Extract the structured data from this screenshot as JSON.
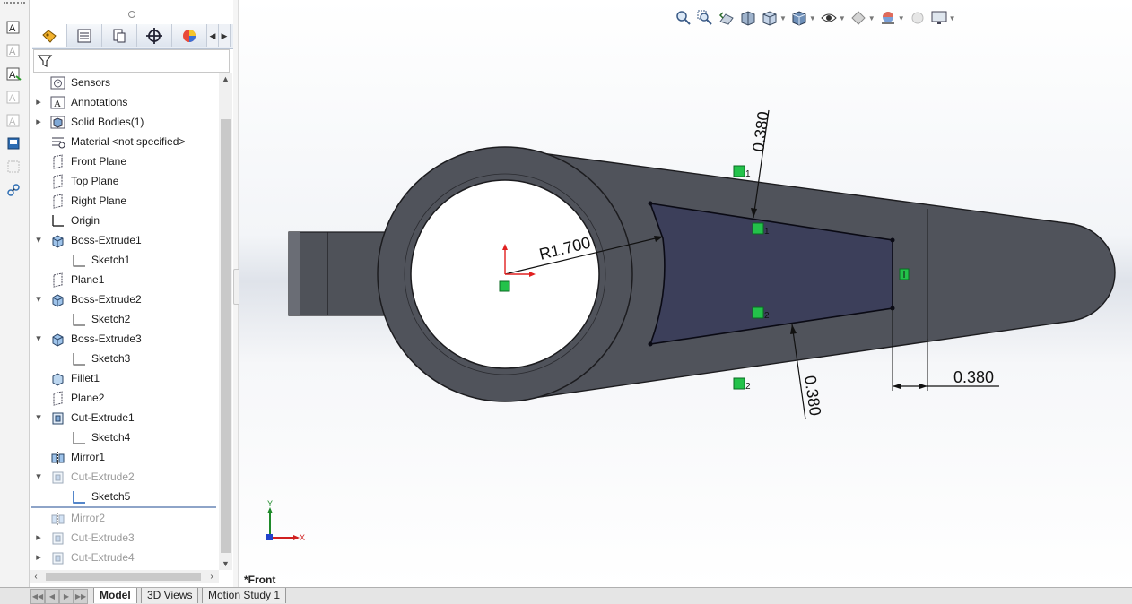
{
  "feature_tree": {
    "items": [
      {
        "label": "Sensors",
        "icon": "sensor-icon",
        "expand": false,
        "indent": 0,
        "dim": false
      },
      {
        "label": "Annotations",
        "icon": "annotations-icon",
        "expand": true,
        "indent": 0,
        "dim": false
      },
      {
        "label": "Solid Bodies(1)",
        "icon": "solid-bodies-icon",
        "expand": true,
        "indent": 0,
        "dim": false
      },
      {
        "label": "Material <not specified>",
        "icon": "material-icon",
        "expand": false,
        "indent": 0,
        "dim": false
      },
      {
        "label": "Front Plane",
        "icon": "plane-icon",
        "expand": false,
        "indent": 0,
        "dim": false
      },
      {
        "label": "Top Plane",
        "icon": "plane-icon",
        "expand": false,
        "indent": 0,
        "dim": false
      },
      {
        "label": "Right Plane",
        "icon": "plane-icon",
        "expand": false,
        "indent": 0,
        "dim": false
      },
      {
        "label": "Origin",
        "icon": "origin-icon",
        "expand": false,
        "indent": 0,
        "dim": false
      },
      {
        "label": "Boss-Extrude1",
        "icon": "extrude-icon",
        "expand": "open",
        "indent": 0,
        "dim": false
      },
      {
        "label": "Sketch1",
        "icon": "sketch-icon",
        "expand": false,
        "indent": 1,
        "dim": false
      },
      {
        "label": "Plane1",
        "icon": "plane-icon",
        "expand": false,
        "indent": 0,
        "dim": false
      },
      {
        "label": "Boss-Extrude2",
        "icon": "extrude-icon",
        "expand": "open",
        "indent": 0,
        "dim": false
      },
      {
        "label": "Sketch2",
        "icon": "sketch-icon",
        "expand": false,
        "indent": 1,
        "dim": false
      },
      {
        "label": "Boss-Extrude3",
        "icon": "extrude-icon",
        "expand": "open",
        "indent": 0,
        "dim": false
      },
      {
        "label": "Sketch3",
        "icon": "sketch-icon",
        "expand": false,
        "indent": 1,
        "dim": false
      },
      {
        "label": "Fillet1",
        "icon": "fillet-icon",
        "expand": false,
        "indent": 0,
        "dim": false
      },
      {
        "label": "Plane2",
        "icon": "plane-icon",
        "expand": false,
        "indent": 0,
        "dim": false
      },
      {
        "label": "Cut-Extrude1",
        "icon": "cut-extrude-icon",
        "expand": "open",
        "indent": 0,
        "dim": false
      },
      {
        "label": "Sketch4",
        "icon": "sketch-icon",
        "expand": false,
        "indent": 1,
        "dim": false
      },
      {
        "label": "Mirror1",
        "icon": "mirror-icon",
        "expand": false,
        "indent": 0,
        "dim": false
      },
      {
        "label": "Cut-Extrude2",
        "icon": "cut-extrude-icon",
        "expand": "open",
        "indent": 0,
        "dim": true
      },
      {
        "label": "Sketch5",
        "icon": "sketch-active-icon",
        "expand": false,
        "indent": 1,
        "dim": false
      },
      {
        "label": "Mirror2",
        "icon": "mirror-icon",
        "expand": false,
        "indent": 0,
        "dim": true
      },
      {
        "label": "Cut-Extrude3",
        "icon": "cut-extrude-icon",
        "expand": true,
        "indent": 0,
        "dim": true
      },
      {
        "label": "Cut-Extrude4",
        "icon": "cut-extrude-icon",
        "expand": true,
        "indent": 0,
        "dim": true
      }
    ]
  },
  "fm_tabs": [
    "featuremanager-tab-icon",
    "propertymanager-tab-icon",
    "configuration-manager-tab-icon",
    "dimxpert-tab-icon",
    "display-manager-tab-icon"
  ],
  "sketch": {
    "radius_dim": "R1.700",
    "top_dim": "0.380",
    "bottom_dim": "0.380",
    "right_dim": "0.380",
    "relation_labels": [
      "1",
      "1",
      "2",
      "2"
    ]
  },
  "triad": {
    "x": "X",
    "y": "Y"
  },
  "view_label": "*Front",
  "bottom_tabs": {
    "model": "Model",
    "views3d": "3D Views",
    "motion": "Motion Study 1"
  },
  "colors": {
    "part": "#50535b",
    "part_dark": "#3a3c42",
    "sketch_fill": "#3c3f5a",
    "relation": "#23c24a",
    "accent": "#2b6fd6"
  }
}
